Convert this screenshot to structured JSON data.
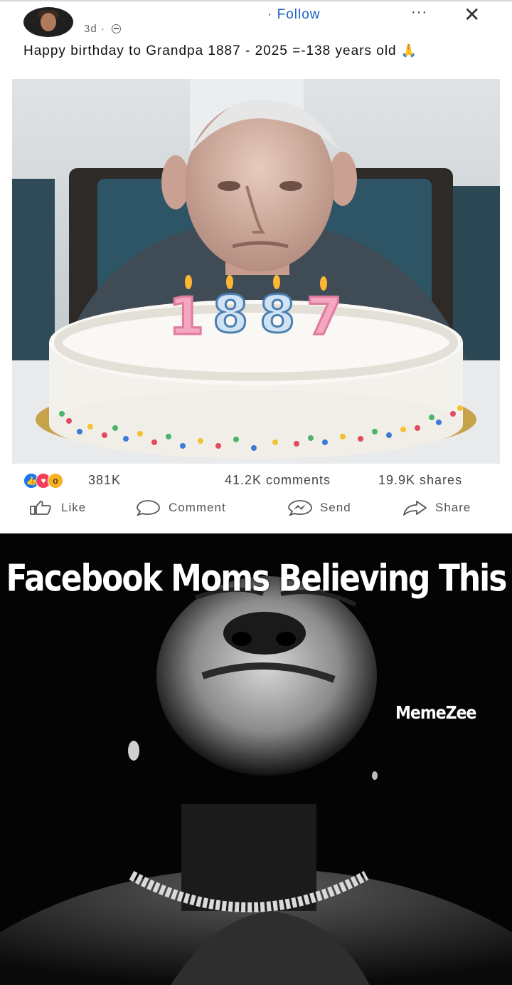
{
  "post": {
    "time": "3d ·",
    "follow_label": "· Follow",
    "more_label": "···",
    "close_label": "✕",
    "caption": "Happy birthday to Grandpa 1887 - 2025 =-138 years old",
    "caption_emoji": "🙏",
    "photo": {
      "candle_numbers": [
        "1",
        "8",
        "8",
        "7"
      ]
    },
    "stats": {
      "reactions": [
        "like",
        "love",
        "wow"
      ],
      "reaction_count": "381K",
      "comments": "41.2K comments",
      "shares": "19.9K shares"
    },
    "actions": {
      "like": "Like",
      "comment": "Comment",
      "send": "Send",
      "share": "Share"
    }
  },
  "meme": {
    "headline": "Facebook Moms Believing This",
    "watermark": "MemeZee"
  },
  "colors": {
    "link_blue": "#1b5fc7",
    "like_blue": "#1877f2",
    "love_red": "#f33e58",
    "wow_yellow": "#f7b125"
  }
}
